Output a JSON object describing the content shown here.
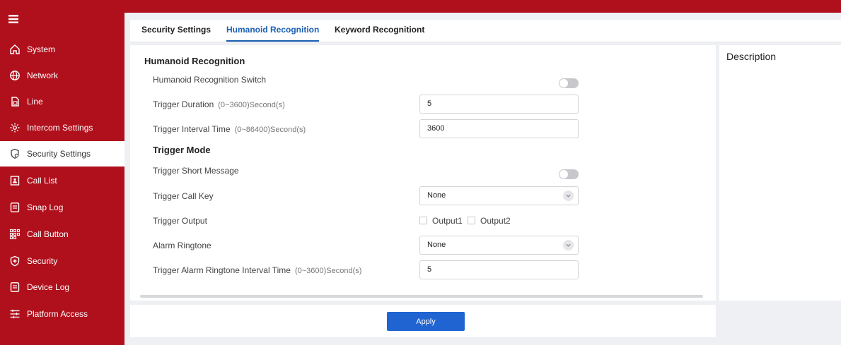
{
  "sidebar": {
    "items": [
      {
        "label": "System",
        "icon": "home-icon"
      },
      {
        "label": "Network",
        "icon": "globe-icon"
      },
      {
        "label": "Line",
        "icon": "sim-icon"
      },
      {
        "label": "Intercom Settings",
        "icon": "gear-icon"
      },
      {
        "label": "Security Settings",
        "icon": "shield-gear-icon",
        "active": true
      },
      {
        "label": "Call List",
        "icon": "contact-book-icon"
      },
      {
        "label": "Snap Log",
        "icon": "document-icon"
      },
      {
        "label": "Call Button",
        "icon": "keypad-icon"
      },
      {
        "label": "Security",
        "icon": "shield-plus-icon"
      },
      {
        "label": "Device Log",
        "icon": "document-icon"
      },
      {
        "label": "Platform Access",
        "icon": "sliders-icon"
      }
    ]
  },
  "tabs": [
    {
      "label": "Security Settings"
    },
    {
      "label": "Humanoid Recognition",
      "active": true
    },
    {
      "label": "Keyword Recognitiont"
    }
  ],
  "form": {
    "section1_title": "Humanoid Recognition",
    "switch_label": "Humanoid Recognition Switch",
    "duration_label": "Trigger Duration",
    "duration_hint": "(0~3600)Second(s)",
    "duration_value": "5",
    "interval_label": "Trigger Interval Time",
    "interval_hint": "(0~86400)Second(s)",
    "interval_value": "3600",
    "section2_title": "Trigger Mode",
    "short_msg_label": "Trigger Short Message",
    "call_key_label": "Trigger Call Key",
    "call_key_value": "None",
    "output_label": "Trigger Output",
    "output1_label": "Output1",
    "output2_label": "Output2",
    "ringtone_label": "Alarm Ringtone",
    "ringtone_value": "None",
    "ringtone_interval_label": "Trigger Alarm Ringtone Interval Time",
    "ringtone_interval_hint": "(0~3600)Second(s)",
    "ringtone_interval_value": "5"
  },
  "description": {
    "title": "Description"
  },
  "footer": {
    "apply_label": "Apply"
  },
  "colors": {
    "brand": "#b0101c",
    "accent": "#1a5fb4",
    "button": "#1f64d1"
  }
}
